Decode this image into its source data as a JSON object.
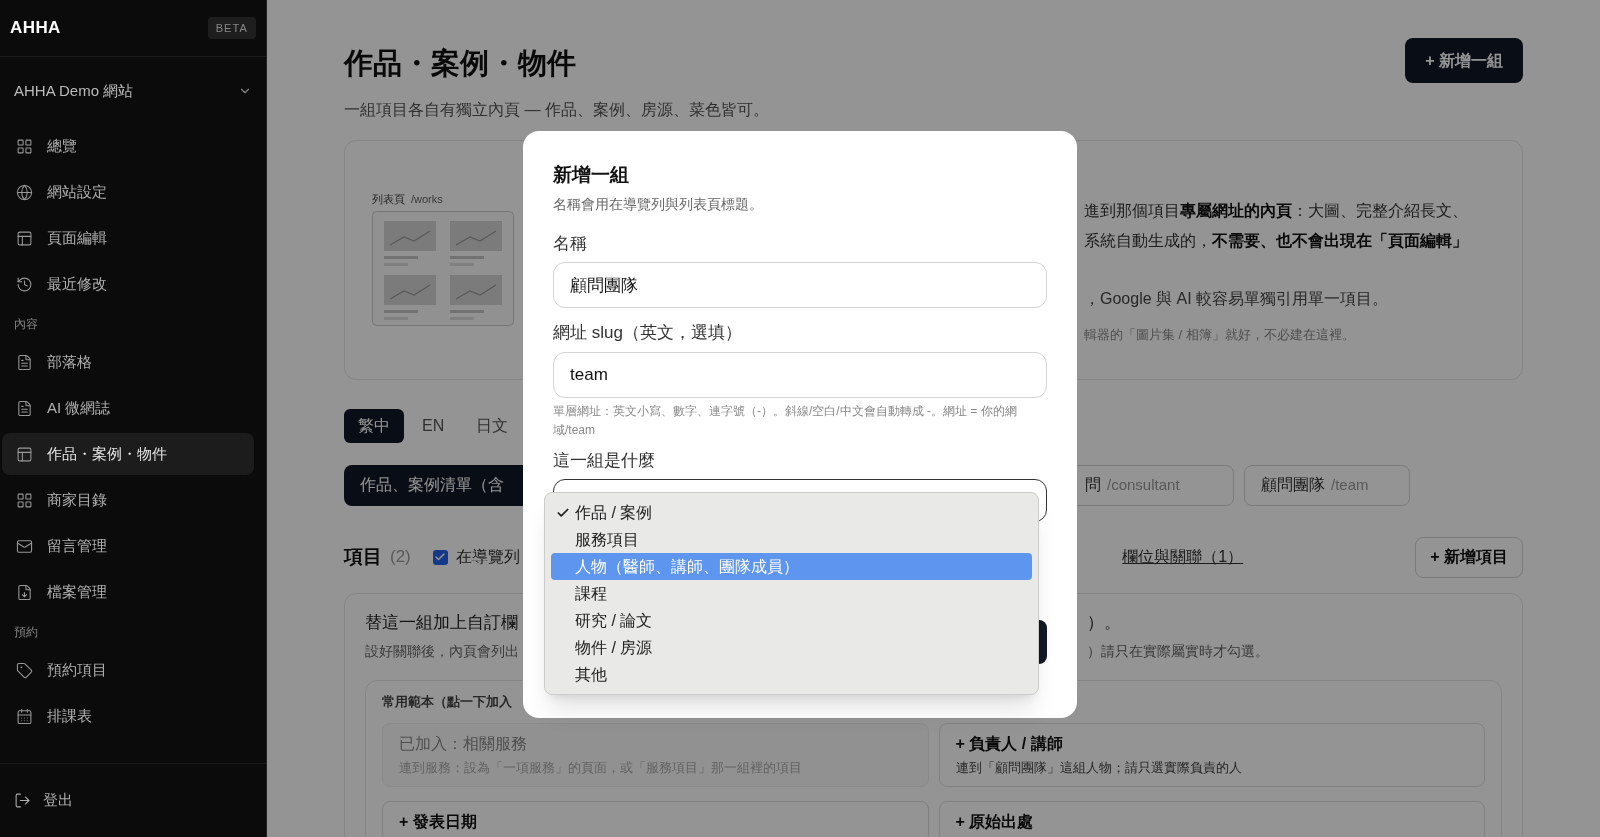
{
  "sidebar": {
    "brand": "AHHA",
    "badge": "BETA",
    "site": "AHHA Demo 網站",
    "sections": [
      {
        "items": [
          {
            "label": "總覽",
            "selected": false
          },
          {
            "label": "網站設定",
            "selected": false
          },
          {
            "label": "頁面編輯",
            "selected": false
          },
          {
            "label": "最近修改",
            "selected": false
          }
        ]
      },
      {
        "heading": "內容",
        "items": [
          {
            "label": "部落格",
            "selected": false
          },
          {
            "label": "AI 微網誌",
            "selected": false
          },
          {
            "label": "作品・案例・物件",
            "selected": true
          },
          {
            "label": "商家目錄",
            "selected": false
          },
          {
            "label": "留言管理",
            "selected": false
          },
          {
            "label": "檔案管理",
            "selected": false
          }
        ]
      },
      {
        "heading": "預約",
        "items": [
          {
            "label": "預約項目",
            "selected": false
          },
          {
            "label": "排課表",
            "selected": false
          }
        ]
      }
    ],
    "logout": "登出"
  },
  "page": {
    "title": "作品・案例・物件",
    "subtitle": "一組項目各自有獨立內頁 — 作品、案例、房源、菜色皆可。",
    "add_group_button": "+ 新增一組",
    "intro": {
      "preview_label": "列表頁",
      "preview_path": "/works",
      "lines": [
        {
          "kind": "body",
          "text": "進到那個項目**專屬網址的內頁**：大圖、完整介紹長文、"
        },
        {
          "kind": "body",
          "text": "系統自動生成的，**不需要、也不會出現在「頁面編輯」**"
        },
        {
          "kind": "body",
          "text": "，Google 與 AI 較容易單獨引用單一項目。"
        },
        {
          "kind": "note",
          "text": "輯器的「圖片集 / 相簿」就好，不必建在這裡。"
        }
      ]
    },
    "languages": [
      {
        "label": "繁中",
        "selected": true
      },
      {
        "label": "EN",
        "selected": false
      },
      {
        "label": "日文",
        "selected": false
      }
    ],
    "groups": [
      {
        "label": "作品、案例清單（含",
        "selected": true
      },
      {
        "label": "問",
        "slug": "/consultant",
        "selected": false
      },
      {
        "label": "顧問團隊",
        "slug": "/team",
        "selected": false
      }
    ],
    "items_heading": "項目",
    "items_count": "(2)",
    "show_in_nav": {
      "label": "在導覽列",
      "checked": true
    },
    "fields_link": "欄位與關聯（1）",
    "add_item_button": "+ 新增項目",
    "fields": {
      "title_left": "替這一組加上自訂欄",
      "title_right": "）。",
      "desc_left": "設好關聯後，內頁會列出",
      "desc_right": "）請只在實際屬實時才勾選。",
      "templates_label": "常用範本（點一下加入",
      "templates": [
        {
          "title": "已加入：相關服務",
          "desc": "連到服務：設為「一項服務」的頁面，或「服務項目」那一組裡的項目",
          "added": true
        },
        {
          "title": "+ 負責人 / 講師",
          "desc": "連到「顧問團隊」這組人物；請只選實際負責的人",
          "added": false
        },
        {
          "title": "+ 發表日期",
          "added": false
        },
        {
          "title": "+ 原始出處",
          "added": false
        }
      ]
    }
  },
  "dialog": {
    "title": "新增一組",
    "description": "名稱會用在導覽列與列表頁標題。",
    "name_label": "名稱",
    "name_value": "顧問團隊",
    "slug_label": "網址 slug（英文，選填）",
    "slug_value": "team",
    "slug_hint": "單層網址：英文小寫、數字、連字號（-）。斜線/空白/中文會自動轉成 -。網址 = 你的網域/team",
    "type_label": "這一組是什麼",
    "options": [
      {
        "label": "作品 / 案例",
        "checked": true,
        "highlighted": false
      },
      {
        "label": "服務項目",
        "checked": false,
        "highlighted": false
      },
      {
        "label": "人物（醫師、講師、團隊成員）",
        "checked": false,
        "highlighted": true
      },
      {
        "label": "課程",
        "checked": false,
        "highlighted": false
      },
      {
        "label": "研究 / 論文",
        "checked": false,
        "highlighted": false
      },
      {
        "label": "物件 / 房源",
        "checked": false,
        "highlighted": false
      },
      {
        "label": "其他",
        "checked": false,
        "highlighted": false
      }
    ]
  }
}
